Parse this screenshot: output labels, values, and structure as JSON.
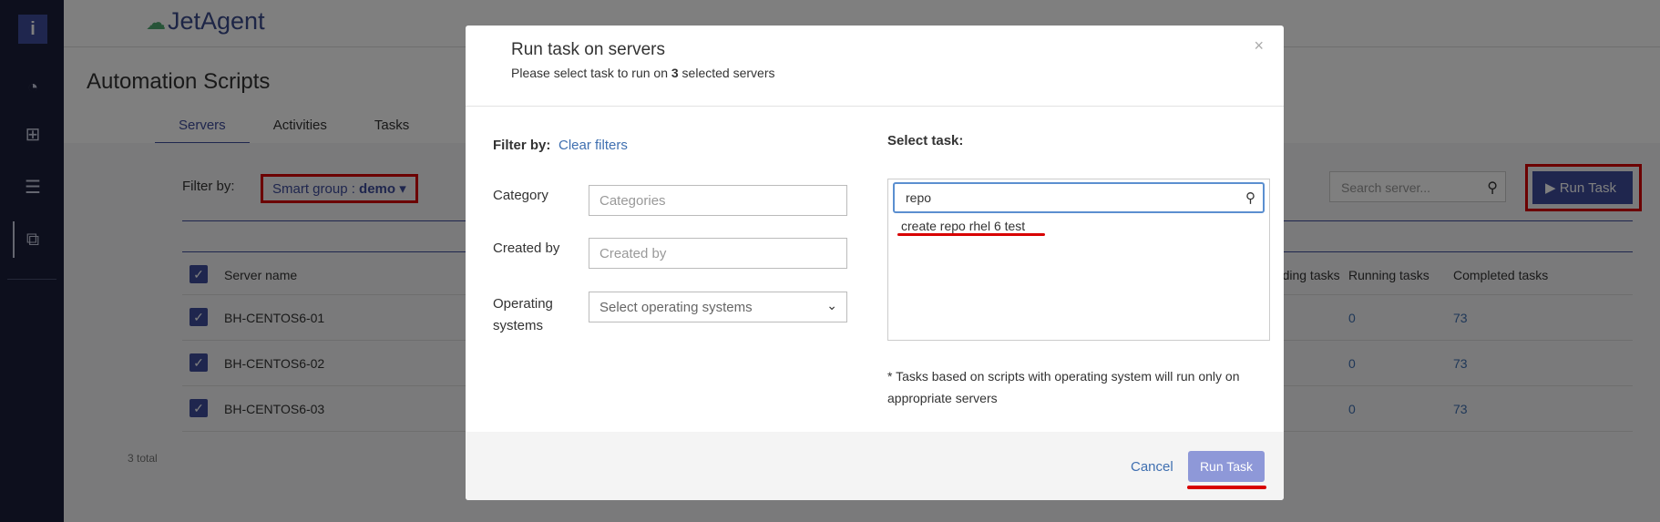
{
  "app": {
    "brand": "JetAgent",
    "logo_letter": "i"
  },
  "page": {
    "title": "Automation Scripts",
    "tabs": [
      "Servers",
      "Activities",
      "Tasks"
    ],
    "filter_label": "Filter by:",
    "smart_group_prefix": "Smart group : ",
    "smart_group_value": "demo",
    "search_placeholder": "Search server...",
    "run_task_label": "Run Task",
    "columns": {
      "server_name": "Server name",
      "pending": "ending tasks",
      "running": "Running tasks",
      "completed": "Completed tasks"
    },
    "rows": [
      {
        "name": "BH-CENTOS6-01",
        "running": "0",
        "completed": "73"
      },
      {
        "name": "BH-CENTOS6-02",
        "running": "0",
        "completed": "73"
      },
      {
        "name": "BH-CENTOS6-03",
        "running": "0",
        "completed": "73"
      }
    ],
    "total": "3 total"
  },
  "modal": {
    "title": "Run task on servers",
    "subtitle_pre": "Please select task to run on ",
    "subtitle_count": "3",
    "subtitle_post": " selected servers",
    "filter_by": "Filter by:",
    "clear_filters": "Clear filters",
    "category_label": "Category",
    "category_placeholder": "Categories",
    "created_by_label": "Created by",
    "created_by_placeholder": "Created by",
    "os_label_1": "Operating",
    "os_label_2": "systems",
    "os_placeholder": "Select operating systems",
    "select_task_label": "Select task:",
    "task_search_value": "repo",
    "task_result": "create repo rhel 6 test",
    "note": "* Tasks based on scripts with operating system will run only on appropriate servers",
    "cancel": "Cancel",
    "run": "Run Task"
  },
  "colors": {
    "accent": "#3f4d9c",
    "highlight": "#d80000",
    "link": "#3f6fb0"
  }
}
